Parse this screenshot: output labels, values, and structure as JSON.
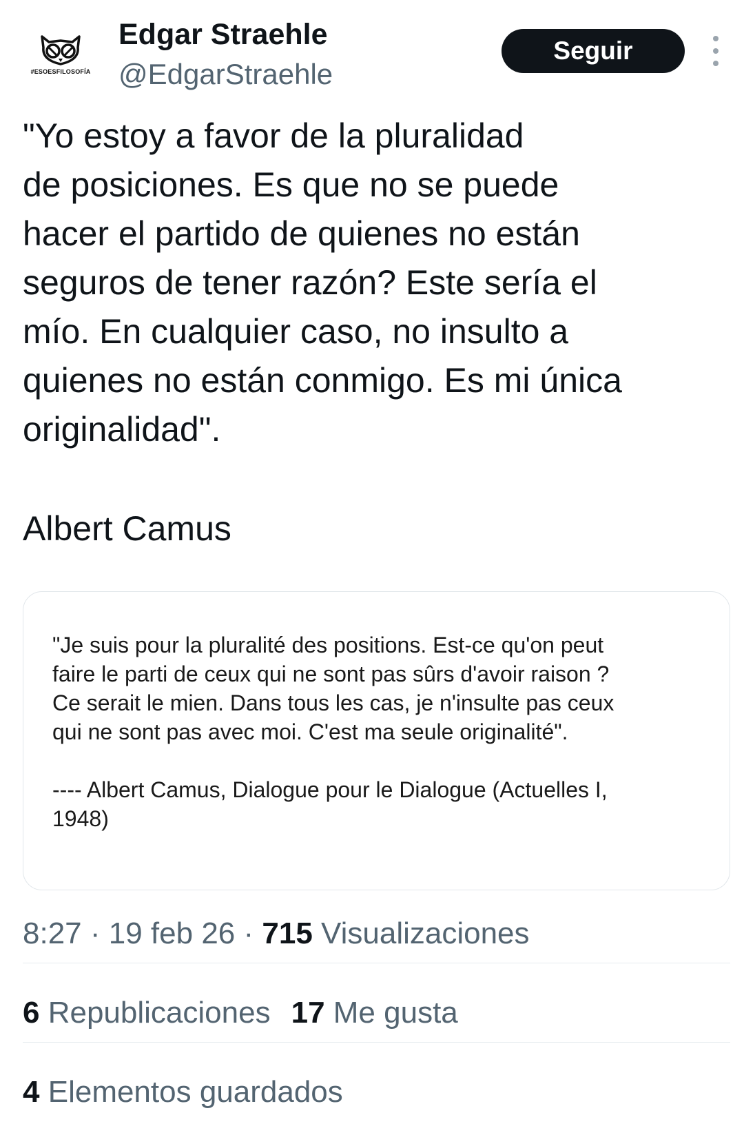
{
  "author": {
    "name": "Edgar Straehle",
    "handle": "@EdgarStraehle",
    "avatar_tag": "#ESOESFILOSOFÍA",
    "avatar_icon": "owl-logo-icon"
  },
  "header": {
    "follow_label": "Seguir",
    "more_icon": "more-vertical-icon"
  },
  "tweet": {
    "text_lines": [
      "\"Yo estoy a favor de la pluralidad",
      "de posiciones. Es que no se puede",
      "hacer el partido de quienes no están",
      "seguros de tener razón? Este sería el",
      "mío. En cualquier caso, no insulto a",
      "quienes no están conmigo. Es mi única",
      "originalidad\"."
    ],
    "signature": "Albert Camus"
  },
  "media": {
    "quote_lines": [
      "\"Je suis pour la pluralité des positions. Est-ce qu'on peut",
      "faire le parti de ceux qui ne sont pas sûrs d'avoir raison ?",
      "Ce serait le mien. Dans tous les cas, je n'insulte pas ceux",
      "qui ne sont pas avec moi. C'est ma seule originalité\"."
    ],
    "source_lines": [
      "---- Albert Camus, Dialogue pour le Dialogue (Actuelles I,",
      "1948)"
    ]
  },
  "meta": {
    "time": "8:27",
    "separator": "·",
    "date": "19 feb 26",
    "views_count": "715",
    "views_label": "Visualizaciones"
  },
  "stats": {
    "reposts_count": "6",
    "reposts_label": "Republicaciones",
    "likes_count": "17",
    "likes_label": "Me gusta",
    "bookmarks_count": "4",
    "bookmarks_label": "Elementos guardados"
  },
  "colors": {
    "text_primary": "#0f1419",
    "text_secondary": "#536471",
    "button_bg": "#0f1419",
    "divider": "#e6ebee"
  }
}
